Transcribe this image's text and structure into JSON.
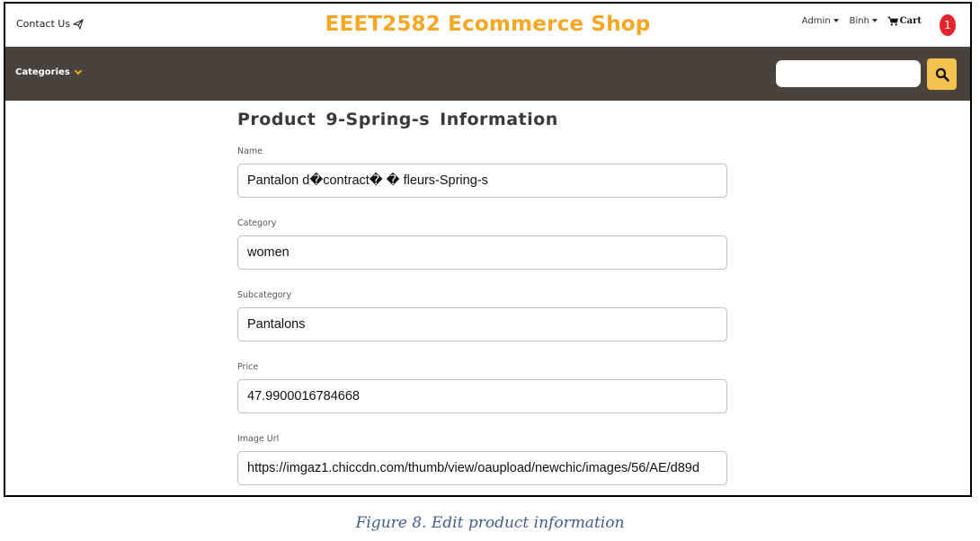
{
  "header": {
    "contact_label": "Contact Us",
    "brand_title": "EEET2582 Ecommerce Shop",
    "admin_label": "Admin",
    "user_label": "Binh",
    "cart_label": "Cart",
    "cart_count": "1"
  },
  "nav": {
    "categories_label": "Categories",
    "search_value": ""
  },
  "form": {
    "title": "Product  9-Spring-s  Information",
    "fields": [
      {
        "label": "Name",
        "value": "Pantalon d�contract� � fleurs-Spring-s"
      },
      {
        "label": "Category",
        "value": "women"
      },
      {
        "label": "Subcategory",
        "value": "Pantalons"
      },
      {
        "label": "Price",
        "value": "47.9900016784668"
      },
      {
        "label": "Image Url",
        "value": "https://imgaz1.chiccdn.com/thumb/view/oaupload/newchic/images/56/AE/d89d"
      }
    ]
  },
  "caption": "Figure 8. Edit product information",
  "colors": {
    "brand": "#f5a623",
    "navbar": "#4a433d",
    "search_button": "#f2c14e",
    "badge": "#e3262c",
    "caption": "#3f5d8c"
  },
  "icons": [
    "send-icon",
    "chevron-down-icon",
    "cart-icon",
    "search-icon"
  ]
}
